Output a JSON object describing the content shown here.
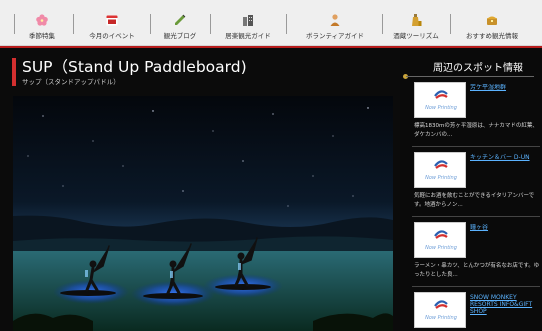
{
  "nav": {
    "items": [
      {
        "label": "季節特集",
        "icon": "cherry-blossom-icon"
      },
      {
        "label": "今月のイベント",
        "icon": "calendar-icon"
      },
      {
        "label": "観光ブログ",
        "icon": "pencil-icon"
      },
      {
        "label": "居楽観光ガイド",
        "icon": "buildings-icon"
      },
      {
        "label": "ボランティアガイド",
        "icon": "guide-person-icon"
      },
      {
        "label": "酒蔵ツーリズム",
        "icon": "sake-bottle-icon"
      },
      {
        "label": "おすすめ観光情報",
        "icon": "treasure-icon"
      }
    ]
  },
  "main": {
    "title": "SUP（Stand Up Paddleboard)",
    "subtitle": "サップ（スタンドアップパドル）"
  },
  "sidebar": {
    "title": "周辺のスポット情報",
    "placeholder_label": "Now Printing",
    "spots": [
      {
        "name": "芳ケ平湿地群",
        "desc": "標高1830mの芳ヶ平湿原は、ナナカマドの紅葉、ダケカンバの..."
      },
      {
        "name": "キッチン＆バー D-UN",
        "desc": "気軽にお酒を飲むことができるイタリアンバーです。地酒からノン..."
      },
      {
        "name": "鐘ヶ谷",
        "desc": "ラーメン・串カツ、とんかつが有名なお店です。ゆったりとした良..."
      },
      {
        "name": "SNOW MONKEY RESORTS INFO&GIFT SHOP",
        "desc": ""
      }
    ]
  },
  "colors": {
    "accent_red": "#d32f2f",
    "link_blue": "#5bb3ff",
    "nav_bg": "#efefef"
  }
}
